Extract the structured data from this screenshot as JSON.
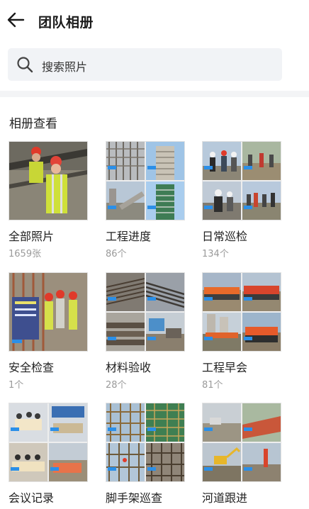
{
  "header": {
    "title": "团队相册",
    "back_icon": "arrow-left-icon"
  },
  "search": {
    "placeholder": "搜索照片",
    "icon": "search-icon"
  },
  "section": {
    "title": "相册查看"
  },
  "colors": {
    "tag_blue": "#2b8fe8",
    "search_bg": "#f1f3f6",
    "muted_text": "#9a9a9a"
  },
  "albums": [
    {
      "name": "全部照片",
      "count": "1659张"
    },
    {
      "name": "工程进度",
      "count": "86个"
    },
    {
      "name": "日常巡检",
      "count": "134个"
    },
    {
      "name": "安全检查",
      "count": "1个"
    },
    {
      "name": "材料验收",
      "count": "28个"
    },
    {
      "name": "工程早会",
      "count": "81个"
    },
    {
      "name": "会议记录",
      "count": ""
    },
    {
      "name": "脚手架巡查",
      "count": ""
    },
    {
      "name": "河道跟进",
      "count": ""
    }
  ]
}
